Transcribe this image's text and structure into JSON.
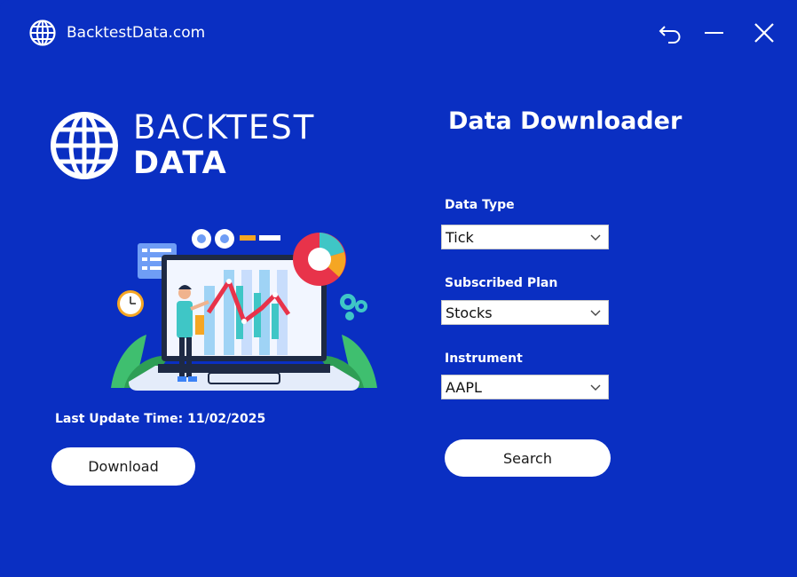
{
  "window": {
    "title": "BacktestData.com",
    "icons": {
      "app": "globe-icon",
      "back": "undo-icon",
      "minimize": "minimize-icon",
      "close": "close-icon"
    }
  },
  "logo": {
    "line1": "BACKTEST",
    "line2": "DATA"
  },
  "left": {
    "last_update": "Last Update Time: 11/02/2025",
    "download_label": "Download"
  },
  "right": {
    "heading": "Data Downloader",
    "fields": [
      {
        "label": "Data Type",
        "value": "Tick"
      },
      {
        "label": "Subscribed Plan",
        "value": "Stocks"
      },
      {
        "label": "Instrument",
        "value": "AAPL"
      }
    ],
    "search_label": "Search"
  },
  "colors": {
    "background": "#0a2fc2",
    "button": "#ffffff",
    "accent_red": "#e8334a",
    "accent_teal": "#3fc6c6"
  }
}
